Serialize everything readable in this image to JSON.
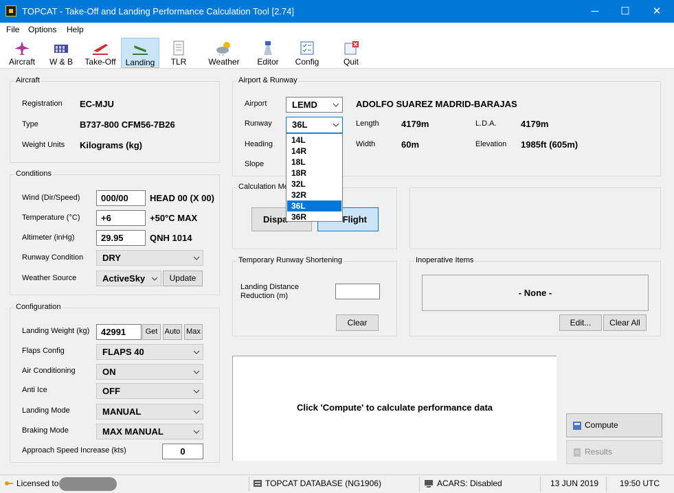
{
  "window": {
    "title": "TOPCAT - Take-Off and Landing Performance Calculation Tool [2.74]",
    "controls": {
      "minimize": "─",
      "maximize": "☐",
      "close": "✕"
    }
  },
  "menu": [
    "File",
    "Options",
    "Help"
  ],
  "toolbar": [
    {
      "label": "Aircraft",
      "icon": "aircraft-icon"
    },
    {
      "label": "W & B",
      "icon": "weight-balance-icon"
    },
    {
      "label": "Take-Off",
      "icon": "takeoff-icon"
    },
    {
      "label": "Landing",
      "icon": "landing-icon",
      "active": true
    },
    {
      "label": "TLR",
      "icon": "document-icon"
    },
    {
      "label": "Weather",
      "icon": "weather-icon"
    },
    {
      "label": "Editor",
      "icon": "editor-icon"
    },
    {
      "label": "Config",
      "icon": "config-icon"
    },
    {
      "label": "Quit",
      "icon": "quit-icon"
    }
  ],
  "aircraft": {
    "title": "Aircraft",
    "registration_label": "Registration",
    "registration": "EC-MJU",
    "type_label": "Type",
    "type": "B737-800 CFM56-7B26",
    "units_label": "Weight Units",
    "units": "Kilograms (kg)"
  },
  "conditions": {
    "title": "Conditions",
    "wind_label": "Wind (Dir/Speed)",
    "wind": "000/00",
    "wind_info": "HEAD 00 (X 00)",
    "temp_label": "Temperature (°C)",
    "temp": "+6",
    "temp_info": "+50°C MAX",
    "alt_label": "Altimeter (inHg)",
    "alt": "29.95",
    "alt_info": "QNH 1014",
    "rwycond_label": "Runway Condition",
    "rwycond": "DRY",
    "wxsrc_label": "Weather Source",
    "wxsrc": "ActiveSky",
    "update_button": "Update"
  },
  "configuration": {
    "title": "Configuration",
    "weight_label": "Landing Weight (kg)",
    "weight": "42991",
    "get_button": "Get",
    "auto_button": "Auto",
    "max_button": "Max",
    "flaps_label": "Flaps Config",
    "flaps": "FLAPS 40",
    "ac_label": "Air Conditioning",
    "ac": "ON",
    "antiice_label": "Anti Ice",
    "antiice": "OFF",
    "mode_label": "Landing Mode",
    "mode": "MANUAL",
    "braking_label": "Braking Mode",
    "braking": "MAX MANUAL",
    "approach_label": "Approach Speed Increase (kts)",
    "approach": "0"
  },
  "airport": {
    "title": "Airport & Runway",
    "airport_label": "Airport",
    "airport": "LEMD",
    "airport_name": "ADOLFO SUAREZ MADRID-BARAJAS",
    "runway_label": "Runway",
    "runway": "36L",
    "heading_label": "Heading",
    "slope_label": "Slope",
    "length_label": "Length",
    "length": "4179m",
    "lda_label": "L.D.A.",
    "lda": "4179m",
    "width_label": "Width",
    "width": "60m",
    "elev_label": "Elevation",
    "elev": "1985ft (605m)",
    "runway_options": [
      "14L",
      "14R",
      "18L",
      "18R",
      "32L",
      "32R",
      "36L",
      "36R"
    ],
    "runway_selected_index": 6
  },
  "calc_method": {
    "title": "Calculation Me",
    "dispatch_button": "Dispa",
    "inflight_button": "Flight"
  },
  "shortening": {
    "title": "Temporary Runway Shortening",
    "label_line1": "Landing Distance",
    "label_line2": "Reduction (m)",
    "value": "",
    "clear_button": "Clear"
  },
  "inoperative": {
    "title": "Inoperative Items",
    "list_text": "- None -",
    "edit_button": "Edit...",
    "clearall_button": "Clear All"
  },
  "results": {
    "message": "Click 'Compute' to calculate performance data"
  },
  "actions": {
    "compute_button": "Compute",
    "results_button": "Results"
  },
  "status": {
    "license": "Licensed to",
    "database": "TOPCAT DATABASE (NG1906)",
    "acars": "ACARS: Disabled",
    "date": "13 JUN 2019",
    "time": "19:50 UTC"
  },
  "colors": {
    "titlebar": "#0078d7",
    "selection": "#0078d7",
    "active_tab": "#cce4f7"
  }
}
